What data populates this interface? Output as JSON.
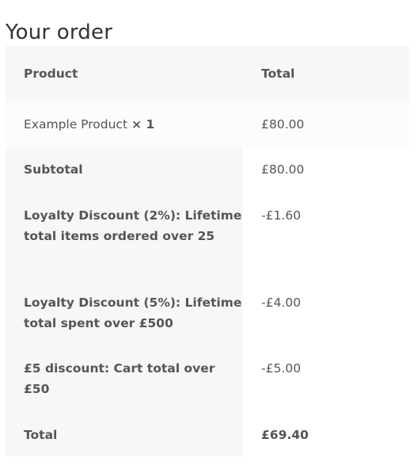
{
  "heading": "Your order",
  "table": {
    "col_product": "Product",
    "col_total": "Total",
    "item": {
      "name": "Example Product",
      "qty": "× 1",
      "total": "£80.00"
    },
    "subtotal": {
      "label": "Subtotal",
      "value": "£80.00"
    },
    "loyalty_items": {
      "label": "Loyalty Discount (2%): Lifetime total items ordered over 25",
      "value": "-£1.60"
    },
    "loyalty_spent": {
      "label": "Loyalty Discount (5%): Lifetime total spent over £500",
      "value": "-£4.00"
    },
    "cart_discount": {
      "label": "£5 discount: Cart total over £50",
      "value": "-£5.00"
    },
    "total": {
      "label": "Total",
      "value": "£69.40"
    }
  }
}
